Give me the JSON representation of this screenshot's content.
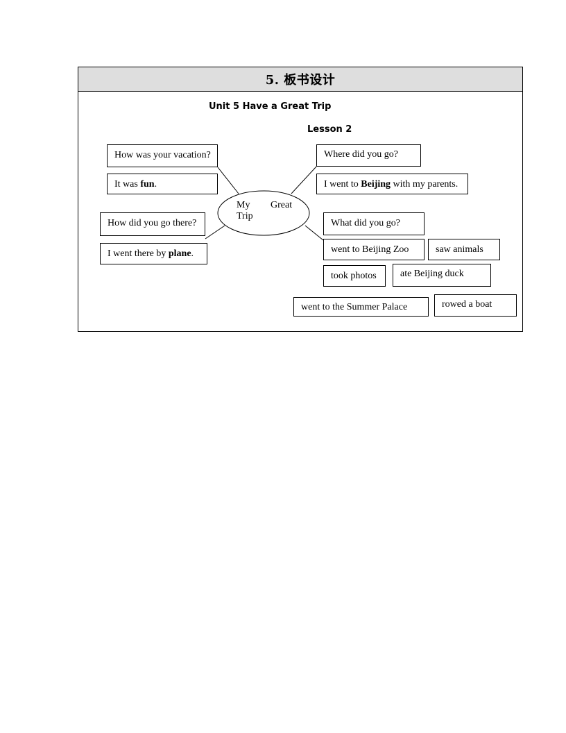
{
  "section_header": "5. 板书设计",
  "unit_title": "Unit 5 Have a Great Trip",
  "lesson_title": "Lesson 2",
  "center": {
    "word1": "My",
    "word2": "Great",
    "word3": "Trip"
  },
  "left_boxes": [
    {
      "text": "How was your vacation?"
    },
    {
      "pre": "It was ",
      "bold": "fun",
      "post": "."
    },
    {
      "text": "How did you go there?"
    },
    {
      "pre": "I went there by ",
      "bold": "plane",
      "post": "."
    }
  ],
  "right_boxes": [
    {
      "text": "Where did you go?"
    },
    {
      "pre": "I went to ",
      "bold": "Beijing",
      "post": " with my parents."
    },
    {
      "text": "What did you go?"
    },
    {
      "text": "went to Beijing Zoo"
    },
    {
      "text": "saw animals"
    },
    {
      "text": "took photos"
    },
    {
      "text": "ate Beijing duck"
    },
    {
      "text": "went to the Summer Palace"
    },
    {
      "text": "rowed a boat"
    }
  ]
}
